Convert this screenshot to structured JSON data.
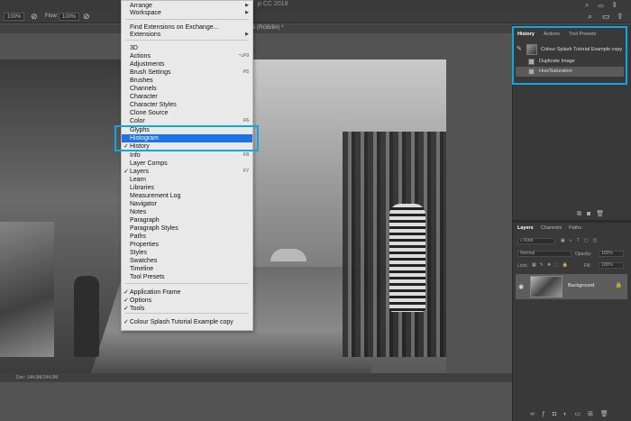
{
  "app": {
    "title": "p CC 2018"
  },
  "options": {
    "zoom": "100%",
    "flow_label": "Flow:",
    "flow_value": "100%",
    "zoom_right": "100%"
  },
  "document": {
    "tab_title": "% (RGB/8#) *",
    "doc_size": "Doc: 144.0M/144.0M"
  },
  "menu": {
    "items": [
      {
        "label": "Arrange",
        "has_submenu": true
      },
      {
        "label": "Workspace",
        "has_submenu": true
      },
      {
        "label": "Find Extensions on Exchange..."
      },
      {
        "label": "Extensions",
        "has_submenu": true
      },
      {
        "label": "3D"
      },
      {
        "label": "Actions",
        "shortcut": "⌥F9"
      },
      {
        "label": "Adjustments"
      },
      {
        "label": "Brush Settings",
        "shortcut": "F5"
      },
      {
        "label": "Brushes"
      },
      {
        "label": "Channels"
      },
      {
        "label": "Character"
      },
      {
        "label": "Character Styles"
      },
      {
        "label": "Clone Source"
      },
      {
        "label": "Color",
        "shortcut": "F6"
      },
      {
        "label": "Glyphs"
      },
      {
        "label": "Histogram",
        "highlighted": true
      },
      {
        "label": "History",
        "checked": true
      },
      {
        "label": "Info",
        "shortcut": "F8"
      },
      {
        "label": "Layer Comps"
      },
      {
        "label": "Layers",
        "checked": true,
        "shortcut": "F7"
      },
      {
        "label": "Learn"
      },
      {
        "label": "Libraries"
      },
      {
        "label": "Measurement Log"
      },
      {
        "label": "Navigator"
      },
      {
        "label": "Notes"
      },
      {
        "label": "Paragraph"
      },
      {
        "label": "Paragraph Styles"
      },
      {
        "label": "Paths"
      },
      {
        "label": "Properties"
      },
      {
        "label": "Styles"
      },
      {
        "label": "Swatches"
      },
      {
        "label": "Timeline"
      },
      {
        "label": "Tool Presets"
      },
      {
        "label": "Application Frame",
        "checked": true
      },
      {
        "label": "Options",
        "checked": true
      },
      {
        "label": "Tools",
        "checked": true
      },
      {
        "label": "Colour Splash Tutorial Example copy",
        "checked": true
      }
    ],
    "checkmark": "✓",
    "submenu_arrow": "▶"
  },
  "history": {
    "tabs": [
      "History",
      "Actions",
      "Tool Presets"
    ],
    "snapshot_label": "Colour Splash Tutorial Example copy",
    "states": [
      {
        "label": "Duplicate Image"
      },
      {
        "label": "Hue/Saturation",
        "selected": true
      }
    ]
  },
  "layers": {
    "tabs": [
      "Layers",
      "Channels",
      "Paths"
    ],
    "kind_label": "Kind",
    "blend_mode": "Normal",
    "opacity_label": "Opacity:",
    "opacity_value": "100%",
    "lock_label": "Lock:",
    "fill_label": "Fill:",
    "fill_value": "100%",
    "layer_name": "Background"
  },
  "colors": {
    "accent": "#12a6e0",
    "menu_highlight": "#1d72e8"
  }
}
